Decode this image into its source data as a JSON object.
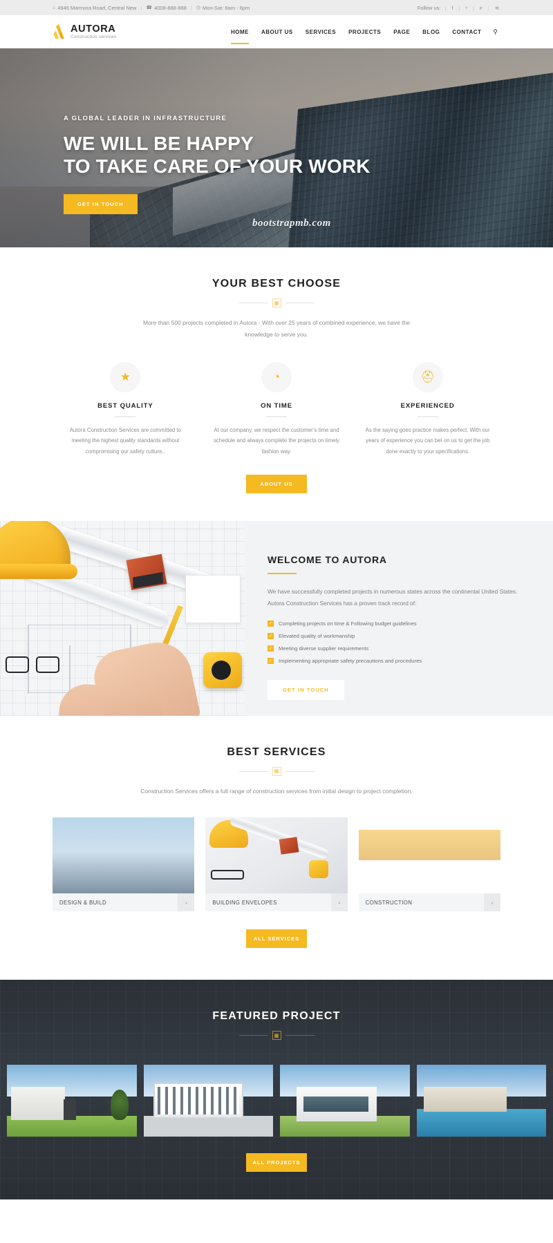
{
  "topbar": {
    "address": "4946 Marmora Road, Central New",
    "address_icon": "home-icon",
    "phone": "4008-888-888",
    "phone_icon": "phone-icon",
    "hours": "Mon-Sat: 8am - 6pm",
    "hours_icon": "clock-icon",
    "follow_label": "Follow us:",
    "socials": [
      {
        "name": "facebook-icon",
        "glyph": "f"
      },
      {
        "name": "twitter-icon",
        "glyph": "ᵛ"
      },
      {
        "name": "pinterest-icon",
        "glyph": "ᴘ"
      },
      {
        "name": "rss-icon",
        "glyph": "≋"
      }
    ]
  },
  "header": {
    "logo_title": "AUTORA",
    "logo_sub": "Construction services",
    "nav": [
      {
        "label": "HOME",
        "active": true
      },
      {
        "label": "ABOUT US",
        "active": false
      },
      {
        "label": "SERVICES",
        "active": false
      },
      {
        "label": "PROJECTS",
        "active": false
      },
      {
        "label": "PAGE",
        "active": false
      },
      {
        "label": "BLOG",
        "active": false
      },
      {
        "label": "CONTACT",
        "active": false
      }
    ],
    "search_icon": "search-icon"
  },
  "hero": {
    "eyebrow": "A GLOBAL LEADER IN INFRASTRUCTURE",
    "title_line1": "WE WILL BE HAPPY",
    "title_line2": "TO TAKE CARE OF YOUR WORK",
    "cta": "GET IN TOUCH",
    "watermark": "bootstrapmb.com"
  },
  "choose": {
    "title": "YOUR BEST CHOOSE",
    "ornament_icon": "building-icon",
    "subtitle": "More than 500 projects completed in Autora - With over 25 years of combined experience, we have the knowledge to serve you.",
    "features": [
      {
        "icon": "medal-icon",
        "glyph": "★",
        "name": "BEST QUALITY",
        "desc": "Autora Construction Services are committed to meeting the highest quality standards without compromising our safety culture.."
      },
      {
        "icon": "calendar-clock-icon",
        "glyph": "◔",
        "name": "ON TIME",
        "desc": "At our company, we respect the customer’s time and schedule and always complete the projects on timely fashion way."
      },
      {
        "icon": "worker-icon",
        "glyph": "⛑",
        "name": "EXPERIENCED",
        "desc": "As the saying goes practice makes perfect. With our years of experience you can bet on us to get the job done exactly to your specifications."
      }
    ],
    "cta": "ABOUT US"
  },
  "welcome": {
    "title": "WELCOME TO AUTORA",
    "text": "We have successfully completed projects in numerous states across the continental United States. Autora Construction Services has a proven track record of:",
    "checklist": [
      "Completing projects on time & Following budget guidelines",
      "Elevated quality of workmanship",
      "Meeting diverse supplier requirements",
      "Implementing appropriate safety precautions and procedures"
    ],
    "check_glyph": "✓",
    "cta": "GET IN TOUCH"
  },
  "services": {
    "title": "BEST SERVICES",
    "ornament_icon": "building-icon",
    "subtitle": "Construction Services offers a full range of construction services from initial design to project completion.",
    "cards": [
      {
        "name": "DESIGN & BUILD",
        "arrow": "›",
        "image": "construction-workers-photo"
      },
      {
        "name": "BUILDING ENVELOPES",
        "arrow": "›",
        "image": "blueprint-tools-photo"
      },
      {
        "name": "CONSTRUCTION",
        "arrow": "›",
        "image": "construction-team-photo"
      }
    ],
    "cta": "ALL SERVICES"
  },
  "featured": {
    "title": "FEATURED PROJECT",
    "ornament_icon": "building-icon",
    "projects": [
      {
        "name": "modern-villa-lawn-photo"
      },
      {
        "name": "white-apartment-block-photo"
      },
      {
        "name": "glass-modern-house-photo"
      },
      {
        "name": "poolside-residence-photo"
      }
    ],
    "cta": "ALL PROJECTS"
  },
  "colors": {
    "accent": "#f5b921",
    "dark": "#2b3037",
    "text": "#7e7e7e",
    "heading": "#1f1f1f"
  }
}
